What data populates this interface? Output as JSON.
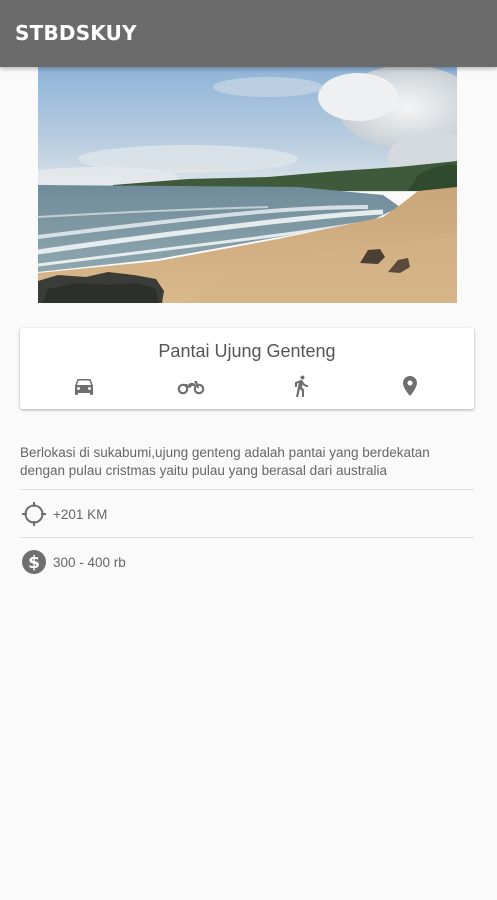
{
  "appbar": {
    "title": "STBDSKUY"
  },
  "hero": {
    "image_description": "beach"
  },
  "place": {
    "name": "Pantai Ujung Genteng",
    "transport_icons": [
      "car-icon",
      "motorcycle-icon",
      "walking-icon",
      "location-pin-icon"
    ]
  },
  "details": {
    "description": "Berlokasi di sukabumi,ujung genteng adalah pantai yang berdekatan dengan pulau cristmas yaitu pulau yang berasal dari australia",
    "distance": "+201 KM",
    "price": "300 - 400 rb"
  },
  "colors": {
    "appbar": "#6b6b6b",
    "background": "#fafafa",
    "icon": "#6f6f6f",
    "text": "#666666"
  }
}
